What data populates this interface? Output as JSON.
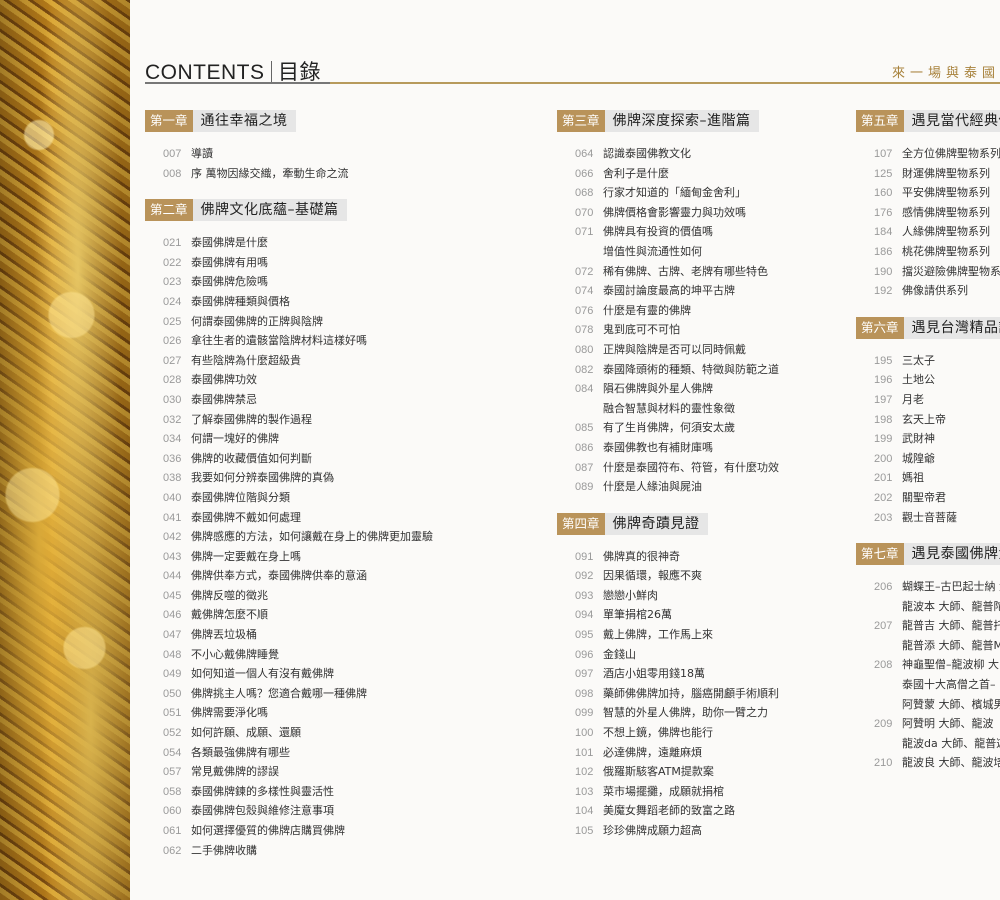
{
  "header": {
    "contents_en": "CONTENTS",
    "contents_zh": "目錄",
    "series_title": "來一場與泰國"
  },
  "columns": [
    {
      "chapters": [
        {
          "num": "第一章",
          "title": "通往幸福之境",
          "entries": [
            {
              "page": "007",
              "text": "導讀"
            },
            {
              "page": "008",
              "text": "序 萬物因緣交織，牽動生命之流"
            }
          ]
        },
        {
          "num": "第二章",
          "title": "佛牌文化底蘊–基礎篇",
          "entries": [
            {
              "page": "021",
              "text": "泰國佛牌是什麼"
            },
            {
              "page": "022",
              "text": "泰國佛牌有用嗎"
            },
            {
              "page": "023",
              "text": "泰國佛牌危險嗎"
            },
            {
              "page": "024",
              "text": "泰國佛牌種類與價格"
            },
            {
              "page": "025",
              "text": "何謂泰國佛牌的正牌與陰牌"
            },
            {
              "page": "026",
              "text": "拿往生者的遺骸當陰牌材料這樣好嗎"
            },
            {
              "page": "027",
              "text": "有些陰牌為什麼超級貴"
            },
            {
              "page": "028",
              "text": "泰國佛牌功效"
            },
            {
              "page": "030",
              "text": "泰國佛牌禁忌"
            },
            {
              "page": "032",
              "text": "了解泰國佛牌的製作過程"
            },
            {
              "page": "034",
              "text": "何謂一塊好的佛牌"
            },
            {
              "page": "036",
              "text": "佛牌的收藏價值如何判斷"
            },
            {
              "page": "038",
              "text": "我要如何分辨泰國佛牌的真偽"
            },
            {
              "page": "040",
              "text": "泰國佛牌位階與分類"
            },
            {
              "page": "041",
              "text": "泰國佛牌不戴如何處理"
            },
            {
              "page": "042",
              "text": "佛牌感應的方法，如何讓戴在身上的佛牌更加靈驗"
            },
            {
              "page": "043",
              "text": "佛牌一定要戴在身上嗎"
            },
            {
              "page": "044",
              "text": "佛牌供奉方式，泰國佛牌供奉的意涵"
            },
            {
              "page": "045",
              "text": "佛牌反噬的徵兆"
            },
            {
              "page": "046",
              "text": "戴佛牌怎麼不順"
            },
            {
              "page": "047",
              "text": "佛牌丟垃圾桶"
            },
            {
              "page": "048",
              "text": "不小心戴佛牌睡覺"
            },
            {
              "page": "049",
              "text": "如何知道一個人有沒有戴佛牌"
            },
            {
              "page": "050",
              "text": "佛牌挑主人嗎？您適合戴哪一種佛牌"
            },
            {
              "page": "051",
              "text": "佛牌需要淨化嗎"
            },
            {
              "page": "052",
              "text": "如何許願、成願、還願"
            },
            {
              "page": "054",
              "text": "各類最強佛牌有哪些"
            },
            {
              "page": "057",
              "text": "常見戴佛牌的謬誤"
            },
            {
              "page": "058",
              "text": "泰國佛牌鍊的多樣性與靈活性"
            },
            {
              "page": "060",
              "text": "泰國佛牌包殼與維修注意事項"
            },
            {
              "page": "061",
              "text": "如何選擇優質的佛牌店購買佛牌"
            },
            {
              "page": "062",
              "text": "二手佛牌收購"
            }
          ]
        }
      ]
    },
    {
      "chapters": [
        {
          "num": "第三章",
          "title": "佛牌深度探索–進階篇",
          "entries": [
            {
              "page": "064",
              "text": "認識泰國佛教文化"
            },
            {
              "page": "066",
              "text": "舍利子是什麼"
            },
            {
              "page": "068",
              "text": "行家才知道的「緬甸金舍利」"
            },
            {
              "page": "070",
              "text": "佛牌價格會影響靈力與功效嗎"
            },
            {
              "page": "071",
              "text": "佛牌具有投資的價值嗎"
            },
            {
              "page": "",
              "text": "增值性與流通性如何"
            },
            {
              "page": "072",
              "text": "稀有佛牌、古牌、老牌有哪些特色"
            },
            {
              "page": "074",
              "text": "泰國討論度最高的坤平古牌"
            },
            {
              "page": "076",
              "text": "什麼是有靈的佛牌"
            },
            {
              "page": "078",
              "text": "鬼到底可不可怕"
            },
            {
              "page": "080",
              "text": "正牌與陰牌是否可以同時佩戴"
            },
            {
              "page": "082",
              "text": "泰國降頭術的種類、特徵與防範之道"
            },
            {
              "page": "084",
              "text": "隕石佛牌與外星人佛牌"
            },
            {
              "page": "",
              "text": "融合智慧與材料的靈性象徵"
            },
            {
              "page": "085",
              "text": "有了生肖佛牌，何須安太歲"
            },
            {
              "page": "086",
              "text": "泰國佛教也有補財庫嗎"
            },
            {
              "page": "087",
              "text": "什麼是泰國符布、符管，有什麼功效"
            },
            {
              "page": "089",
              "text": "什麼是人緣油與屍油"
            }
          ]
        },
        {
          "num": "第四章",
          "title": "佛牌奇蹟見證",
          "entries": [
            {
              "page": "091",
              "text": "佛牌真的很神奇"
            },
            {
              "page": "092",
              "text": "因果循環，報應不爽"
            },
            {
              "page": "093",
              "text": "戀戀小鮮肉"
            },
            {
              "page": "094",
              "text": "單筆捐棺26萬"
            },
            {
              "page": "095",
              "text": "戴上佛牌，工作馬上來"
            },
            {
              "page": "096",
              "text": "金錢山"
            },
            {
              "page": "097",
              "text": "酒店小姐零用錢18萬"
            },
            {
              "page": "098",
              "text": "藥師佛佛牌加持，腦癌開顱手術順利"
            },
            {
              "page": "099",
              "text": "智慧的外星人佛牌，助你一臂之力"
            },
            {
              "page": "100",
              "text": "不想上鏡，佛牌也能行"
            },
            {
              "page": "101",
              "text": "必達佛牌，遠離麻煩"
            },
            {
              "page": "102",
              "text": "俄羅斯駭客ATM提款案"
            },
            {
              "page": "103",
              "text": "菜市場擺攤，成願就捐棺"
            },
            {
              "page": "104",
              "text": "美魔女舞蹈老師的致富之路"
            },
            {
              "page": "105",
              "text": "珍珍佛牌成願力超高"
            }
          ]
        }
      ]
    },
    {
      "chapters": [
        {
          "num": "第五章",
          "title": "遇見當代經典佛",
          "entries": [
            {
              "page": "107",
              "text": "全方位佛牌聖物系列"
            },
            {
              "page": "125",
              "text": "財運佛牌聖物系列"
            },
            {
              "page": "160",
              "text": "平安佛牌聖物系列"
            },
            {
              "page": "176",
              "text": "感情佛牌聖物系列"
            },
            {
              "page": "184",
              "text": "人緣佛牌聖物系列"
            },
            {
              "page": "186",
              "text": "桃花佛牌聖物系列"
            },
            {
              "page": "190",
              "text": "擋災避險佛牌聖物系"
            },
            {
              "page": "192",
              "text": "佛像請供系列"
            }
          ]
        },
        {
          "num": "第六章",
          "title": "遇見台灣精品諸",
          "entries": [
            {
              "page": "195",
              "text": "三太子"
            },
            {
              "page": "196",
              "text": "土地公"
            },
            {
              "page": "197",
              "text": "月老"
            },
            {
              "page": "198",
              "text": "玄天上帝"
            },
            {
              "page": "199",
              "text": "武財神"
            },
            {
              "page": "200",
              "text": "城隍爺"
            },
            {
              "page": "201",
              "text": "媽祖"
            },
            {
              "page": "202",
              "text": "關聖帝君"
            },
            {
              "page": "203",
              "text": "觀士音菩薩"
            }
          ]
        },
        {
          "num": "第七章",
          "title": "遇見泰國佛牌大",
          "entries": [
            {
              "page": "206",
              "text": "蝴蝶王–古巴起士納 大"
            },
            {
              "page": "",
              "text": "龍波本 大師、龍普陀"
            },
            {
              "page": "207",
              "text": "龍普吉 大師、龍普托"
            },
            {
              "page": "",
              "text": "龍普添 大師、龍普M"
            },
            {
              "page": "208",
              "text": "神龜聖僧–龍波柳 大"
            },
            {
              "page": "",
              "text": "泰國十大高僧之首–"
            },
            {
              "page": "",
              "text": "阿贊蒙 大師、檳城男"
            },
            {
              "page": "209",
              "text": "阿贊明 大師、龍波"
            },
            {
              "page": "",
              "text": "龍波da 大師、龍普迦"
            },
            {
              "page": "210",
              "text": "龍波良 大師、龍波培"
            }
          ]
        }
      ]
    }
  ]
}
